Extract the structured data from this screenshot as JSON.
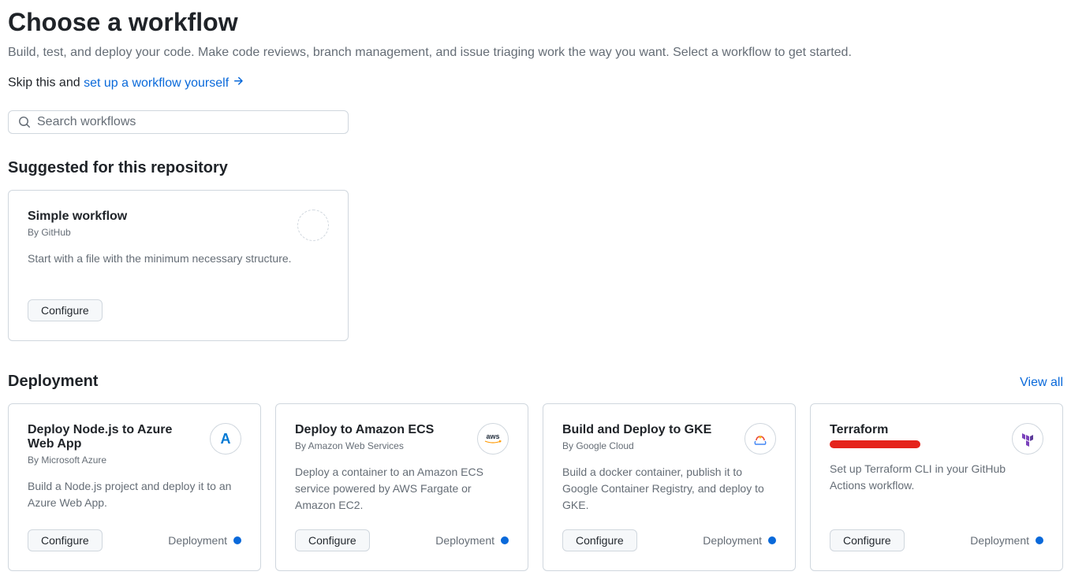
{
  "header": {
    "title": "Choose a workflow",
    "description": "Build, test, and deploy your code. Make code reviews, branch management, and issue triaging work the way you want. Select a workflow to get started.",
    "skip_prefix": "Skip this and ",
    "skip_link": "set up a workflow yourself"
  },
  "search": {
    "placeholder": "Search workflows"
  },
  "sections": {
    "suggested": {
      "title": "Suggested for this repository"
    },
    "deployment": {
      "title": "Deployment",
      "view_all": "View all"
    }
  },
  "suggested_card": {
    "title": "Simple workflow",
    "by": "By GitHub",
    "desc": "Start with a file with the minimum necessary structure.",
    "configure": "Configure"
  },
  "deploy_cards": {
    "azure": {
      "title": "Deploy Node.js to Azure Web App",
      "by": "By Microsoft Azure",
      "desc": "Build a Node.js project and deploy it to an Azure Web App.",
      "configure": "Configure",
      "badge": "Deployment"
    },
    "ecs": {
      "title": "Deploy to Amazon ECS",
      "by": "By Amazon Web Services",
      "desc": "Deploy a container to an Amazon ECS service powered by AWS Fargate or Amazon EC2.",
      "configure": "Configure",
      "badge": "Deployment"
    },
    "gke": {
      "title": "Build and Deploy to GKE",
      "by": "By Google Cloud",
      "desc": "Build a docker container, publish it to Google Container Registry, and deploy to GKE.",
      "configure": "Configure",
      "badge": "Deployment"
    },
    "terraform": {
      "title": "Terraform",
      "desc": "Set up Terraform CLI in your GitHub Actions workflow.",
      "configure": "Configure",
      "badge": "Deployment"
    }
  }
}
